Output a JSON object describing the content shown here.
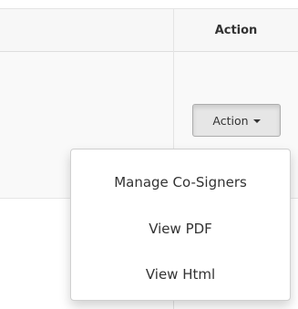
{
  "table": {
    "header": {
      "action_label": "Action"
    }
  },
  "row": {
    "action_button_label": "Action",
    "action_button_icon": "caret-down-icon"
  },
  "dropdown": {
    "items": [
      {
        "label": "Manage Co-Signers"
      },
      {
        "label": "View PDF"
      },
      {
        "label": "View Html"
      }
    ]
  }
}
